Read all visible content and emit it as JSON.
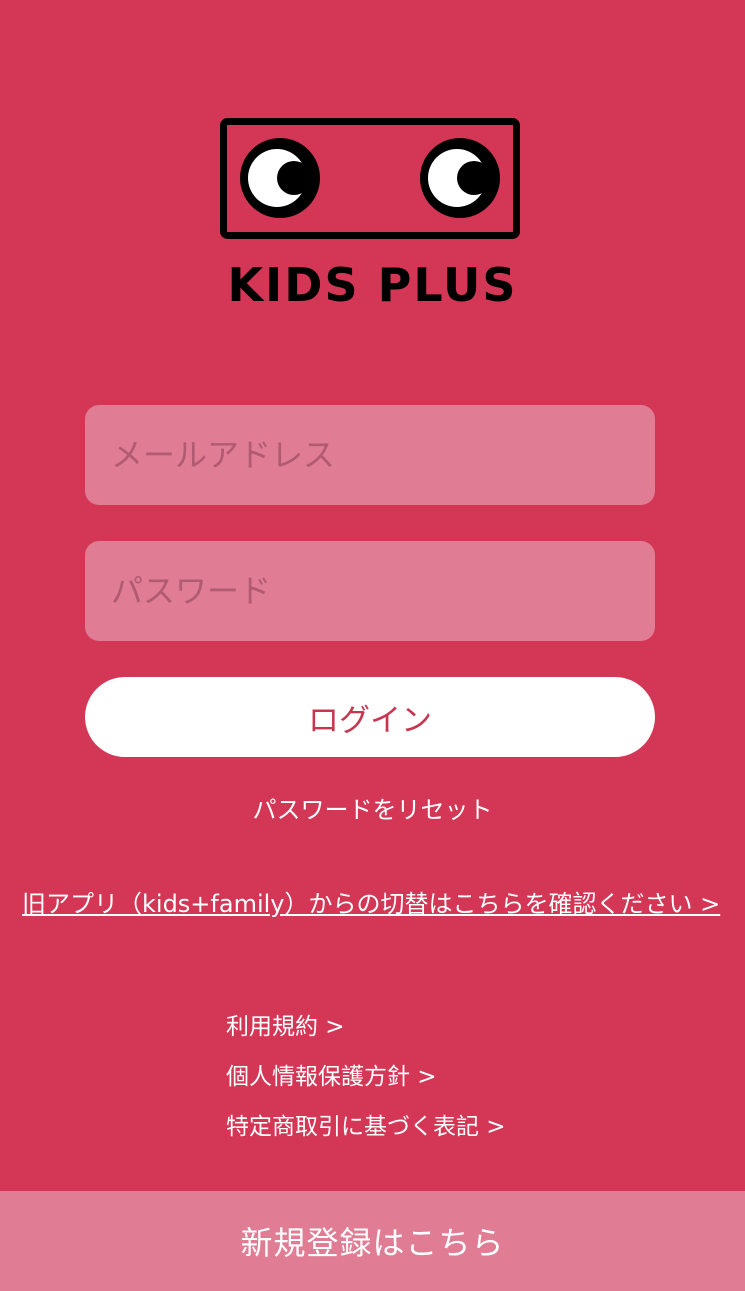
{
  "brand": {
    "name": "KIDS PLUS",
    "logo_icon": "robot-eyes-logo-icon"
  },
  "form": {
    "email_placeholder": "メールアドレス",
    "password_placeholder": "パスワード",
    "login_label": "ログイン"
  },
  "links": {
    "reset_password": "パスワードをリセット",
    "migration": "旧アプリ（kids+family）からの切替はこちらを確認ください >"
  },
  "legal": {
    "items": [
      "利用規約 >",
      "個人情報保護方針 >",
      "特定商取引に基づく表記 >"
    ]
  },
  "footer": {
    "signup_label": "新規登録はこちら"
  },
  "colors": {
    "background": "#d33755",
    "field_bg": "#e07c93",
    "button_bg": "#ffffff",
    "button_text": "#c9354f"
  }
}
